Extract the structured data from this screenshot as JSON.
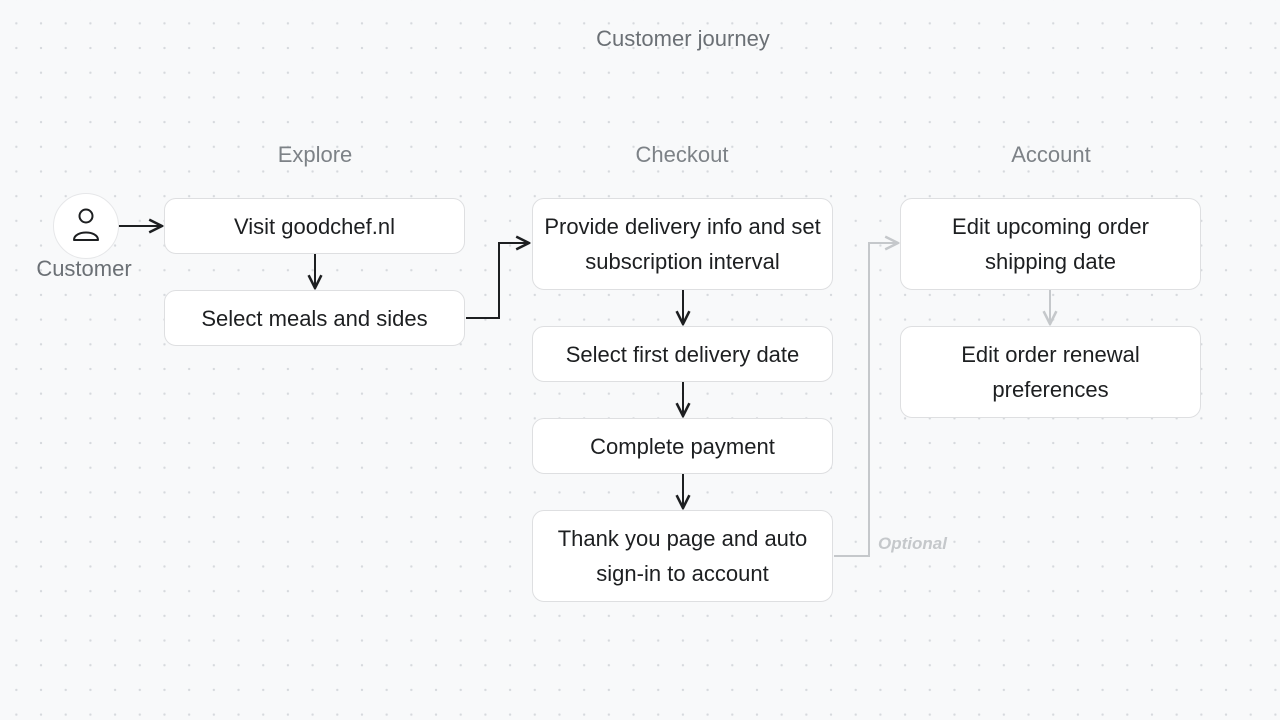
{
  "title": "Customer journey",
  "actor": {
    "label": "Customer",
    "icon": "person-icon"
  },
  "columns": [
    {
      "label": "Explore"
    },
    {
      "label": "Checkout"
    },
    {
      "label": "Account"
    }
  ],
  "nodes": {
    "visit": "Visit goodchef.nl",
    "select_meals": "Select meals and sides",
    "provide_delivery": "Provide delivery info and set subscription interval",
    "first_delivery": "Select first delivery date",
    "payment": "Complete payment",
    "thank_you": "Thank you page and auto sign-in to account",
    "edit_shipping": "Edit upcoming order shipping date",
    "edit_renewal": "Edit order renewal preferences"
  },
  "edges": [
    {
      "from": "customer",
      "to": "visit",
      "style": "solid"
    },
    {
      "from": "visit",
      "to": "select_meals",
      "style": "solid"
    },
    {
      "from": "select_meals",
      "to": "provide_delivery",
      "style": "solid"
    },
    {
      "from": "provide_delivery",
      "to": "first_delivery",
      "style": "solid"
    },
    {
      "from": "first_delivery",
      "to": "payment",
      "style": "solid"
    },
    {
      "from": "payment",
      "to": "thank_you",
      "style": "solid"
    },
    {
      "from": "thank_you",
      "to": "edit_shipping",
      "style": "muted",
      "label": "Optional"
    },
    {
      "from": "edit_shipping",
      "to": "edit_renewal",
      "style": "muted"
    }
  ],
  "colors": {
    "edge": "#1d1f21",
    "edge_muted": "#c5c8cb",
    "node_border": "#dedfe1",
    "background": "#f8f9fa"
  }
}
